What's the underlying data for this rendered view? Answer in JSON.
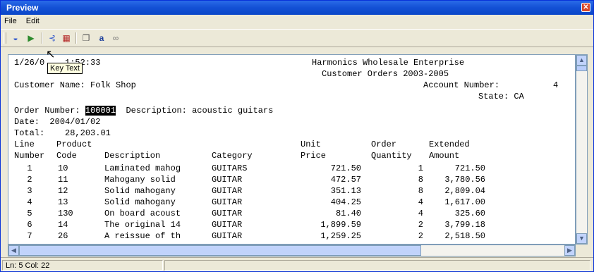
{
  "window": {
    "title": "Preview"
  },
  "menu": {
    "file": "File",
    "edit": "Edit"
  },
  "tooltip": {
    "text": "Key Text"
  },
  "report": {
    "timestamp": "1/26/0",
    "timestamp_tail": "1:52:33",
    "company": "Harmonics Wholesale Enterprise",
    "subtitle": "Customer Orders 2003-2005",
    "customer_label": "Customer Name:",
    "customer_name": "Folk Shop",
    "account_label": "Account Number:",
    "account_number": "4",
    "state_label": "State:",
    "state": "CA",
    "order_label": "Order Number:",
    "order_number": "100001",
    "description_label": "Description:",
    "description": "acoustic guitars",
    "date_label": "Date:",
    "date": "2004/01/02",
    "total_label": "Total:",
    "total": "28,203.01",
    "headers1": [
      "Line",
      "Product",
      "",
      "",
      "Unit",
      "Order",
      "Extended"
    ],
    "headers2": [
      "Number",
      "Code",
      "Description",
      "Category",
      "Price",
      "Quantity",
      "Amount"
    ],
    "rows": [
      [
        "1",
        "10",
        "Laminated mahog",
        "GUITARS",
        "721.50",
        "1",
        "721.50"
      ],
      [
        "2",
        "11",
        "Mahogany solid",
        "GUITAR",
        "472.57",
        "8",
        "3,780.56"
      ],
      [
        "3",
        "12",
        "Solid mahogany",
        "GUITAR",
        "351.13",
        "8",
        "2,809.04"
      ],
      [
        "4",
        "13",
        "Solid mahogany",
        "GUITAR",
        "404.25",
        "4",
        "1,617.00"
      ],
      [
        "5",
        "130",
        "On board acoust",
        "GUITAR",
        "81.40",
        "4",
        "325.60"
      ],
      [
        "6",
        "14",
        "The original 14",
        "GUITAR",
        "1,899.59",
        "2",
        "3,799.18"
      ],
      [
        "7",
        "26",
        "A reissue of th",
        "GUITAR",
        "1,259.25",
        "2",
        "2,518.50"
      ]
    ]
  },
  "status": {
    "ln_label": "Ln:",
    "ln": "5",
    "col_label": "Col:",
    "col": "22"
  }
}
